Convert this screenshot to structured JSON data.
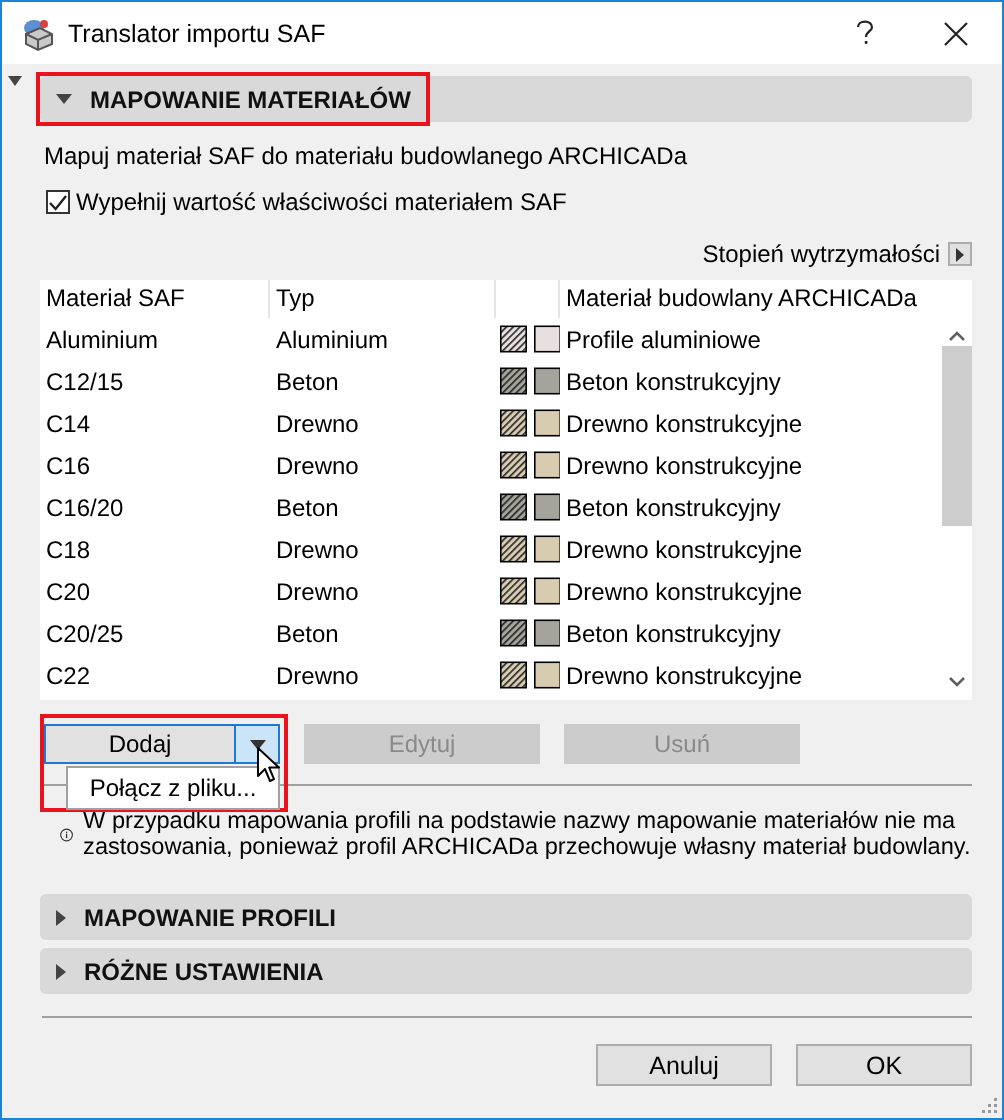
{
  "window": {
    "title": "Translator importu SAF"
  },
  "sections": [
    {
      "title": "MAPOWANIE MATERIAŁÓW",
      "expanded": true,
      "highlighted": true,
      "content": {
        "description": "Mapuj materiał SAF do materiału budowlanego ARCHICADa",
        "fill_checkbox": {
          "label": "Wypełnij wartość właściwości materiałem SAF",
          "checked": true
        },
        "strength_link": {
          "label": "Stopień wytrzymałości"
        },
        "table": {
          "columns": [
            "Materiał SAF",
            "Typ",
            "Materiał budowlany ARCHICADa"
          ],
          "rows": [
            {
              "saf_material": "Aluminium",
              "type": "Aluminium",
              "color": "#e8e0e0",
              "building_material": "Profile aluminiowe"
            },
            {
              "saf_material": "C12/15",
              "type": "Beton",
              "color": "#a4a49c",
              "building_material": "Beton konstrukcyjny"
            },
            {
              "saf_material": "C14",
              "type": "Drewno",
              "color": "#d8ccb0",
              "building_material": "Drewno konstrukcyjne"
            },
            {
              "saf_material": "C16",
              "type": "Drewno",
              "color": "#d8ccb0",
              "building_material": "Drewno konstrukcyjne"
            },
            {
              "saf_material": "C16/20",
              "type": "Beton",
              "color": "#a4a49c",
              "building_material": "Beton konstrukcyjny"
            },
            {
              "saf_material": "C18",
              "type": "Drewno",
              "color": "#d8ccb0",
              "building_material": "Drewno konstrukcyjne"
            },
            {
              "saf_material": "C20",
              "type": "Drewno",
              "color": "#d8ccb0",
              "building_material": "Drewno konstrukcyjne"
            },
            {
              "saf_material": "C20/25",
              "type": "Beton",
              "color": "#a4a49c",
              "building_material": "Beton konstrukcyjny"
            },
            {
              "saf_material": "C22",
              "type": "Drewno",
              "color": "#d8ccb0",
              "building_material": "Drewno konstrukcyjne"
            }
          ]
        },
        "buttons": [
          {
            "label": "Dodaj",
            "kind": "split",
            "disabled": false,
            "highlighted": true
          },
          {
            "label": "Edytuj",
            "kind": "plain",
            "disabled": true,
            "highlighted": false
          },
          {
            "label": "Usuń",
            "kind": "plain",
            "disabled": true,
            "highlighted": false
          }
        ],
        "dropdown_menu": {
          "items": [
            {
              "label": "Połącz z pliku..."
            }
          ]
        },
        "info": "W przypadku mapowania profili na podstawie nazwy mapowanie materiałów nie ma zastosowania, ponieważ profil ARCHICADa przechowuje własny materiał budowlany."
      }
    },
    {
      "title": "MAPOWANIE PROFILI",
      "expanded": false,
      "highlighted": false
    },
    {
      "title": "RÓŻNE USTAWIENIA",
      "expanded": false,
      "highlighted": false
    }
  ],
  "footer_buttons": [
    {
      "label": "Anuluj"
    },
    {
      "label": "OK"
    }
  ]
}
